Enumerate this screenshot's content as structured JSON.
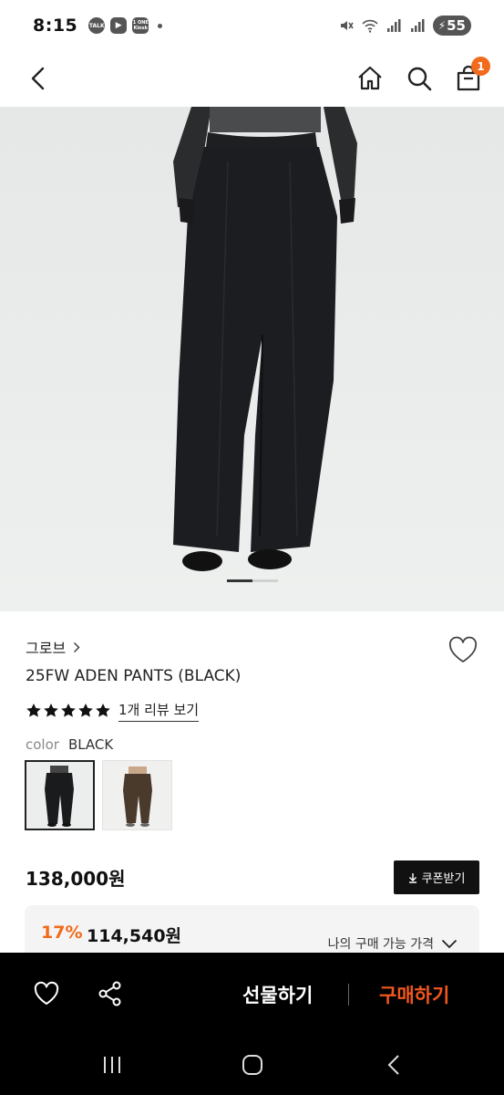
{
  "status": {
    "time": "8:15",
    "app_badges": [
      "TALK",
      "▶",
      "1 ONE Kiosk"
    ],
    "battery": "55"
  },
  "header": {
    "cart_count": "1",
    "icons": [
      "back-icon",
      "home-icon",
      "search-icon",
      "cart-icon"
    ]
  },
  "product": {
    "brand": "그로브",
    "title": "25FW ADEN PANTS (BLACK)",
    "rating_stars": 5,
    "review_link": "1개 리뷰 보기",
    "color_label": "color",
    "color_value": "BLACK",
    "carousel": {
      "count": 2,
      "active": 1
    },
    "price": "138,000원",
    "coupon_label": "쿠폰받기",
    "discount_pct": "17%",
    "discount_price": "114,540원",
    "my_price_label": "나의 구매 가능 가격"
  },
  "action_bar": {
    "gift_label": "선물하기",
    "buy_label": "구매하기"
  },
  "colors": {
    "accent": "#f26a1b",
    "buy": "#f2571f"
  }
}
